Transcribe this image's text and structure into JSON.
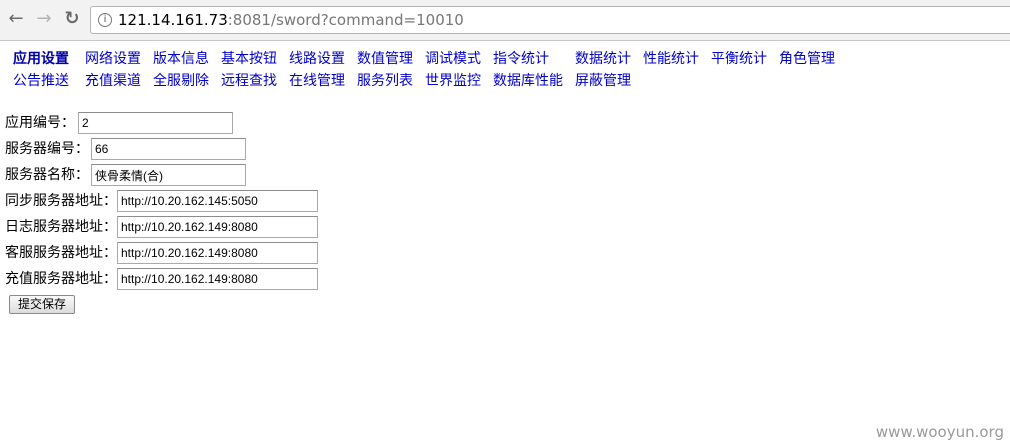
{
  "browser": {
    "url_host": "121.14.161.73",
    "url_rest": ":8081/sword?command=10010",
    "back_glyph": "←",
    "forward_glyph": "→",
    "reload_glyph": "↻",
    "page_icon_glyph": "i"
  },
  "menu": {
    "row1": [
      "应用设置",
      "网络设置",
      "版本信息",
      "基本按钮",
      "线路设置",
      "数值管理",
      "调试模式",
      "指令统计",
      "数据统计",
      "性能统计",
      "平衡统计",
      "角色管理"
    ],
    "row2": [
      "公告推送",
      "充值渠道",
      "全服剔除",
      "远程查找",
      "在线管理",
      "服务列表",
      "世界监控",
      "数据库性能",
      "屏蔽管理"
    ]
  },
  "form": {
    "app_id_label": "应用编号：",
    "app_id_value": "2",
    "server_id_label": "服务器编号：",
    "server_id_value": "66",
    "server_name_label": "服务器名称：",
    "server_name_value": "侠骨柔情(合)",
    "sync_addr_label": "同步服务器地址：",
    "sync_addr_value": "http://10.20.162.145:5050",
    "log_addr_label": "日志服务器地址：",
    "log_addr_value": "http://10.20.162.149:8080",
    "cs_addr_label": "客服服务器地址：",
    "cs_addr_value": "http://10.20.162.149:8080",
    "pay_addr_label": "充值服务器地址：",
    "pay_addr_value": "http://10.20.162.149:8080",
    "submit_label": "提交保存"
  },
  "watermark": "www.wooyun.org"
}
